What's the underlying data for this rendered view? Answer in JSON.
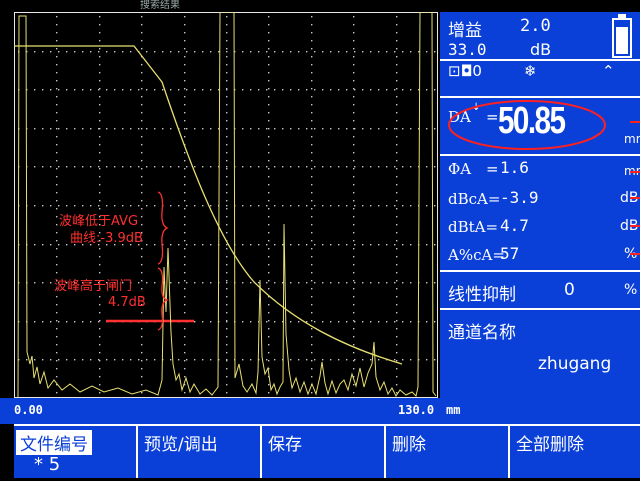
{
  "top_strip": {
    "text": "搜索结果"
  },
  "panel": {
    "gain_label": "增益",
    "gain_value": "2.0",
    "gain_db_value": "33.0",
    "gain_db_unit": "dB",
    "status_icons": "⊡◘0",
    "freeze_icon_glyph": "❄",
    "arrow_glyph": "⌃",
    "da_label": "DA",
    "da_superscript": "↓",
    "da_eq": "=",
    "da_value": "50.85",
    "da_unit": "mm",
    "sa_label": "ΦA",
    "sa_eq": "=",
    "sa_value": "1.6",
    "sa_unit": "mm",
    "dbca_label": "dBcA=",
    "dbca_value": "-3.9",
    "dbca_unit": "dB",
    "dbta_label": "dBtA=",
    "dbta_value": "4.7",
    "dbta_unit": "dB",
    "apca_label": "A%cA=",
    "apca_value": "57",
    "apca_unit": "%",
    "reject_label": "线性抑制",
    "reject_value": "0",
    "reject_unit": "%",
    "channel_label": "通道名称",
    "channel_value": "zhugang",
    "battery_level": 0.85
  },
  "annotations": {
    "avg_line1": "波峰低于AVG",
    "avg_line2": "曲线:-3.9dB",
    "gate_line1": "波峰高于闸门",
    "gate_line2": "4.7dB"
  },
  "axis": {
    "start": "0.00",
    "end": "130.0",
    "unit": "mm"
  },
  "menu": {
    "file_label": "文件编号",
    "file_value": "* 5",
    "preview_label": "预览/调出",
    "save_label": "保存",
    "delete_label": "删除",
    "delete_all_label": "全部删除"
  },
  "colors": {
    "background": "#000000",
    "panel": "#0A3FD8",
    "trace": "#E8E070",
    "annotation": "#FF3030",
    "grid": "#C8C8C8"
  }
}
